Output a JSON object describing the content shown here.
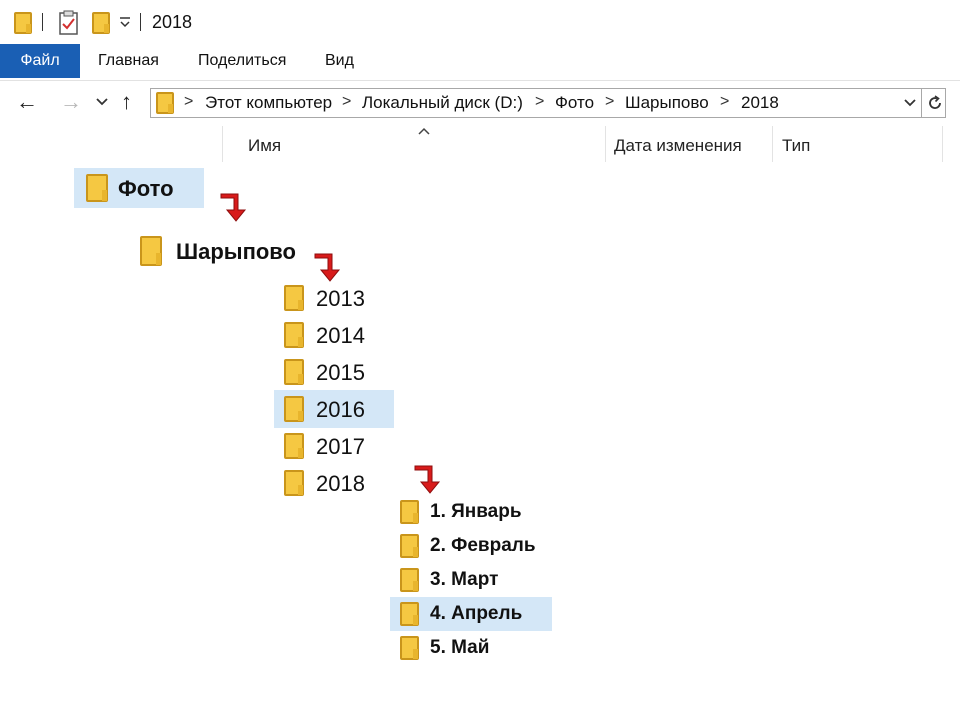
{
  "window": {
    "title": "2018"
  },
  "ribbon": {
    "tabs": [
      "Файл",
      "Главная",
      "Поделиться",
      "Вид"
    ]
  },
  "address": {
    "crumbs": [
      "Этот компьютер",
      "Локальный диск (D:)",
      "Фото",
      "Шарыпово",
      "2018"
    ]
  },
  "columns": {
    "name": "Имя",
    "date": "Дата изменения",
    "type": "Тип"
  },
  "tree": {
    "level1": "Фото",
    "level2": "Шарыпово",
    "years": [
      "2013",
      "2014",
      "2015",
      "2016",
      "2017",
      "2018"
    ],
    "months": [
      "1. Январь",
      "2. Февраль",
      "3. Март",
      "4. Апрель",
      "5. Май"
    ]
  },
  "colors": {
    "accent": "#1a5fb4",
    "selection": "#d4e7f7",
    "arrow": "#d81b1b",
    "folder": "#f5c842"
  }
}
